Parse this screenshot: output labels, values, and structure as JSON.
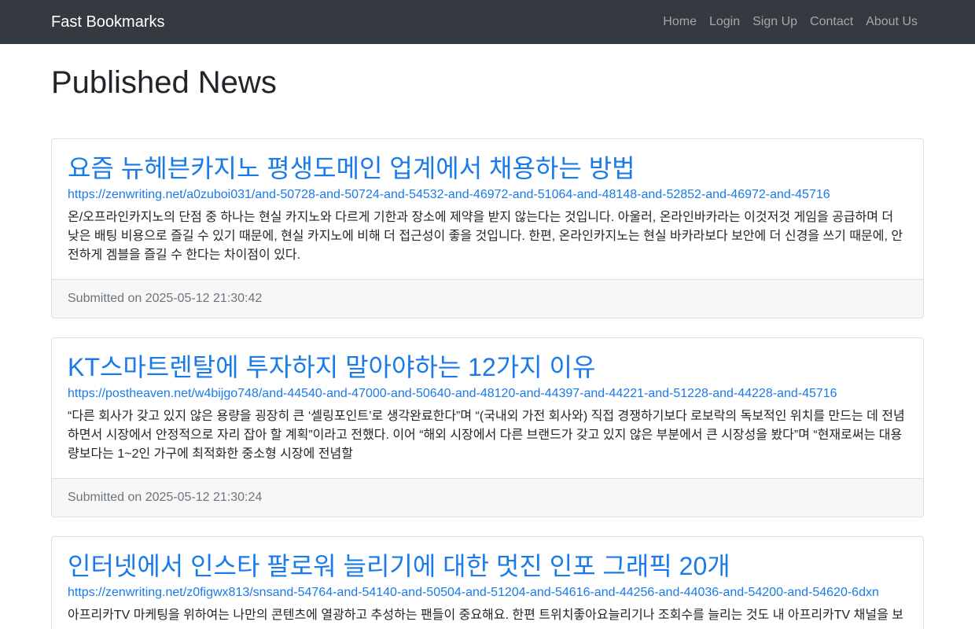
{
  "navbar": {
    "brand": "Fast Bookmarks",
    "links": [
      "Home",
      "Login",
      "Sign Up",
      "Contact",
      "About Us"
    ]
  },
  "page": {
    "title": "Published News"
  },
  "posts": [
    {
      "title": "요즘 뉴헤븐카지노 평생도메인 업계에서 채용하는 방법",
      "url": "https://zenwriting.net/a0zuboi031/and-50728-and-50724-and-54532-and-46972-and-51064-and-48148-and-52852-and-46972-and-45716",
      "excerpt": "온/오프라인카지노의 단점 중 하나는 현실 카지노와 다르게 기한과 장소에 제약을 받지 않는다는 것입니다. 아울러, 온라인바카라는 이것저것 게임을 공급하며 더 낮은 배팅 비용으로 즐길 수 있기 때문에, 현실 카지노에 비해 더 접근성이 좋을 것입니다. 한편, 온라인카지노는 현실 바카라보다 보안에 더 신경을 쓰기 때문에, 안전하게 겜블을 즐길 수 한다는 차이점이 있다.",
      "submitted": "Submitted on 2025-05-12 21:30:42"
    },
    {
      "title": "KT스마트렌탈에 투자하지 말아야하는 12가지 이유",
      "url": "https://postheaven.net/w4bijgo748/and-44540-and-47000-and-50640-and-48120-and-44397-and-44221-and-51228-and-44228-and-45716",
      "excerpt": "“다른 회사가 갖고 있지 않은 용량을 굉장히 큰 ‘셀링포인트’로 생각완료한다”며 “(국내외 가전 회사와) 직접 경쟁하기보다 로보락의 독보적인 위치를 만드는 데 전념하면서 시장에서 안정적으로 자리 잡아 할 계획”이라고 전했다. 이어 “해외 시장에서 다른 브랜드가 갖고 있지 않은 부분에서 큰 시장성을 봤다”며 “현재로써는 대용량보다는 1~2인 가구에 최적화한 중소형 시장에 전념할",
      "submitted": "Submitted on 2025-05-12 21:30:24"
    },
    {
      "title": "인터넷에서 인스타 팔로워 늘리기에 대한 멋진 인포 그래픽 20개",
      "url": "https://zenwriting.net/z0figwx813/snsand-54764-and-54140-and-50504-and-51204-and-54616-and-44256-and-44036-and-54200-and-54620-6dxn",
      "excerpt": "아프리카TV 마케팅을 위하여는 나만의 콘텐츠에 열광하고 추성하는 팬들이 중요해요. 한편 트위치좋아요늘리기나 조회수를 늘리는 것도 내 아프리카TV 채널을 보",
      "submitted": ""
    }
  ]
}
